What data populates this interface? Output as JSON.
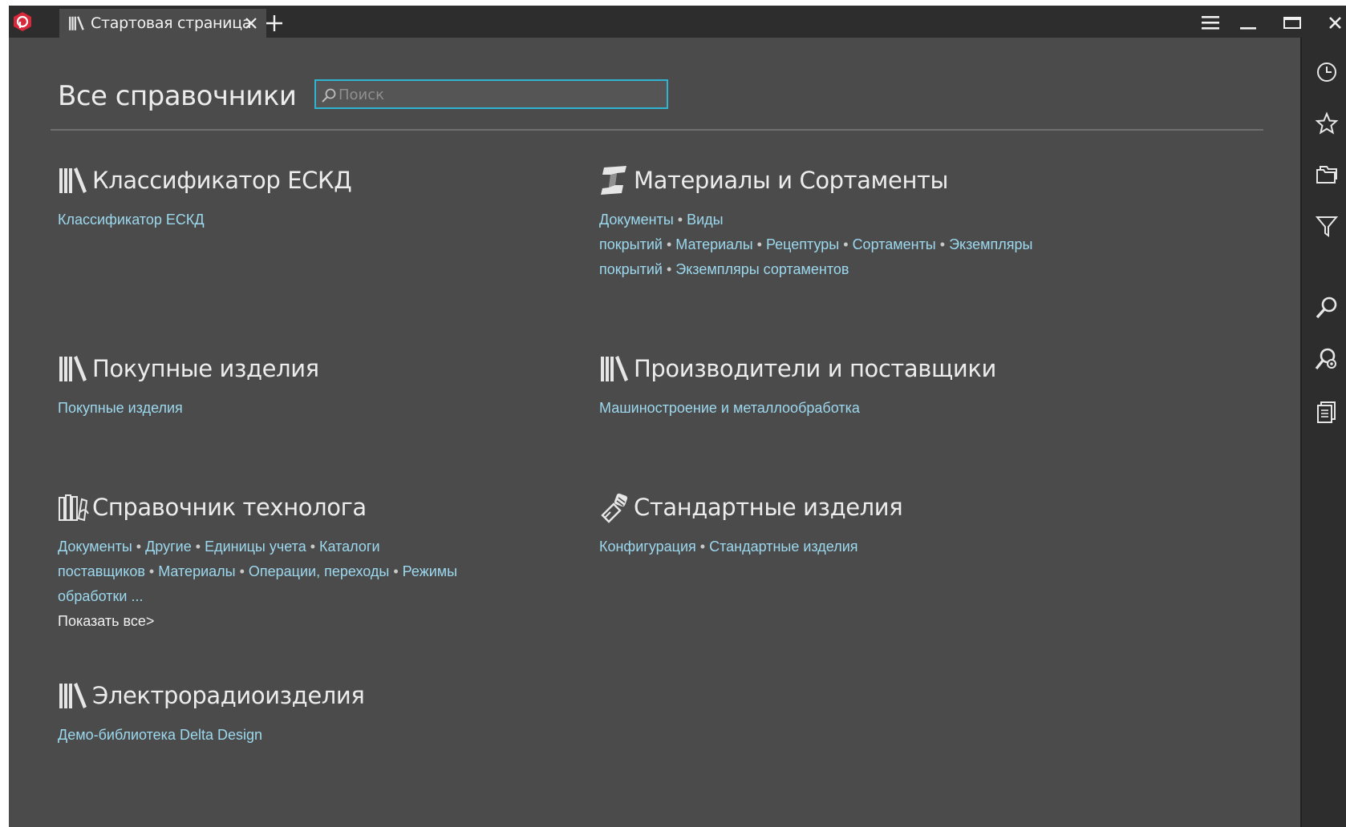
{
  "titlebar": {
    "tab": {
      "label": "Стартовая страница",
      "icon": "library-icon"
    },
    "new_tab_icon": "plus-icon",
    "buttons": [
      "menu-icon",
      "minimize-icon",
      "maximize-icon",
      "close-icon"
    ]
  },
  "main": {
    "title": "Все справочники",
    "search": {
      "placeholder": "Поиск",
      "value": ""
    }
  },
  "categories": [
    {
      "title": "Классификатор ЕСКД",
      "icon": "library-icon",
      "links": [
        "Классификатор ЕСКД"
      ]
    },
    {
      "title": "Материалы и Сортаменты",
      "icon": "i-beam-icon",
      "links": [
        "Документы",
        "Виды покрытий",
        "Материалы",
        "Рецептуры",
        "Сортаменты",
        "Экземпляры покрытий",
        "Экземпляры сортаментов"
      ]
    },
    {
      "title": "Покупные изделия",
      "icon": "library-icon",
      "links": [
        "Покупные изделия"
      ]
    },
    {
      "title": "Производители и поставщики",
      "icon": "library-icon",
      "links": [
        "Машиностроение и металлообработка"
      ]
    },
    {
      "title": "Справочник технолога",
      "icon": "technologist-books-icon",
      "links": [
        "Документы",
        "Другие",
        "Единицы учета",
        "Каталоги поставщиков",
        "Материалы",
        "Операции, переходы",
        "Режимы обработки ..."
      ],
      "show_all": "Показать все>"
    },
    {
      "title": "Стандартные изделия",
      "icon": "bolts-icon",
      "links": [
        "Конфигурация",
        "Стандартные изделия"
      ]
    },
    {
      "title": "Электрорадиоизделия",
      "icon": "library-icon",
      "links": [
        "Демо-библиотека Delta Design"
      ]
    }
  ],
  "rail": [
    "history-icon",
    "favorites-star-icon",
    "folder-icon",
    "filter-icon",
    "search-icon",
    "advanced-search-icon",
    "documents-icon"
  ],
  "colors": {
    "accent": "#2fb4d4",
    "link": "#9cd8ee",
    "background": "#4b4b4b",
    "chrome": "#2d2d2d",
    "logo": "#d9283a"
  }
}
